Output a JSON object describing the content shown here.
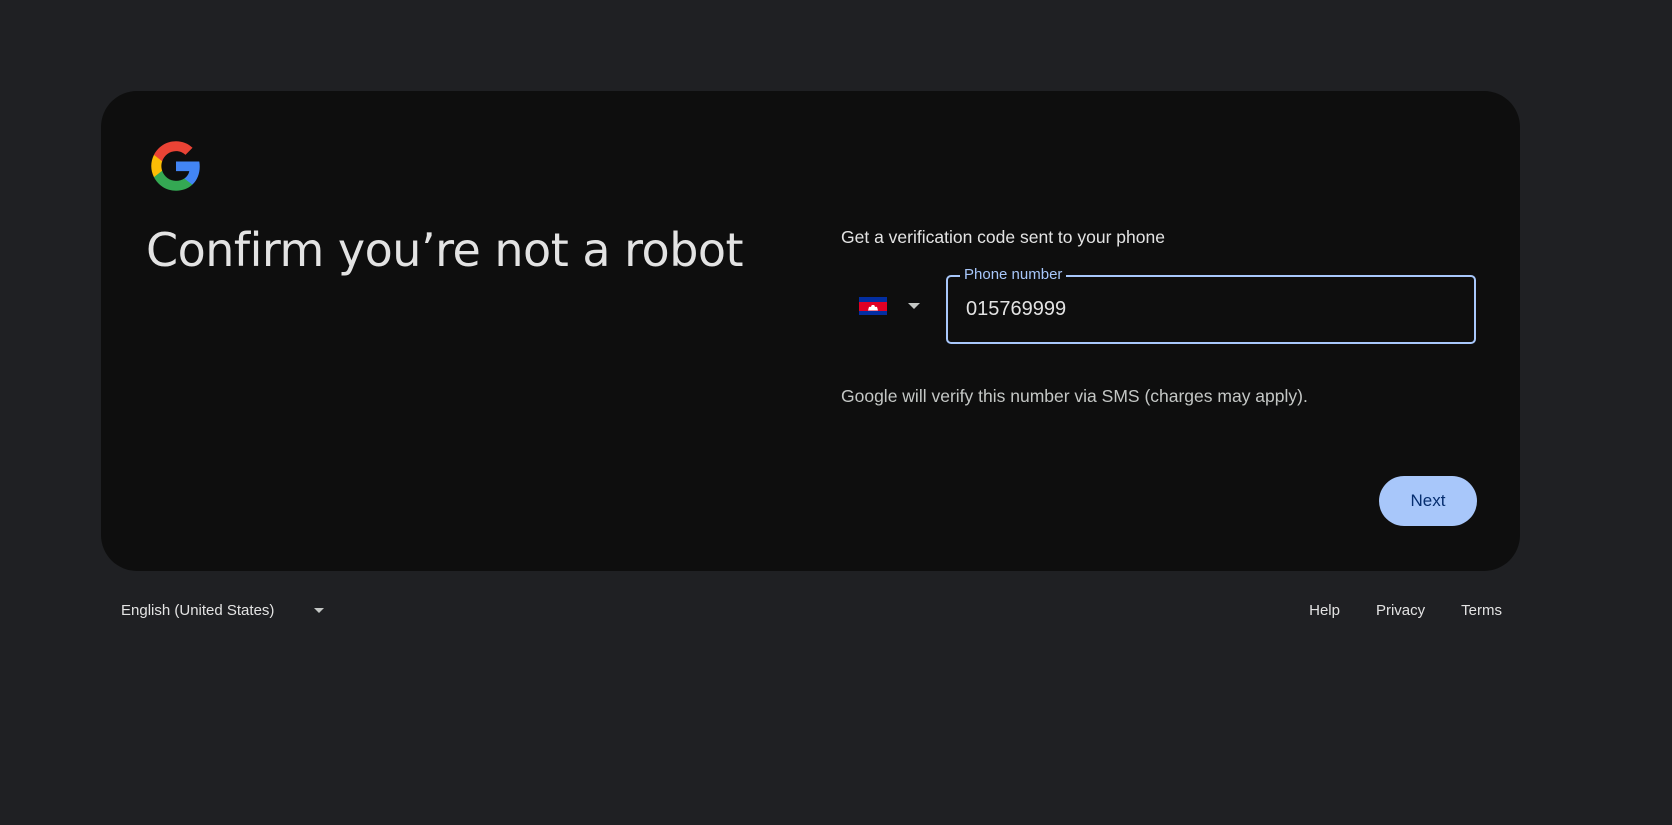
{
  "heading": "Confirm you’re not a robot",
  "logo": {
    "icon": "google-g-icon"
  },
  "verification": {
    "subtitle": "Get a verification code sent to your phone",
    "country": {
      "flag_icon": "cambodia-flag-icon"
    },
    "phone_label": "Phone number",
    "phone_value": "015769999",
    "note": "Google will verify this number via SMS (charges may apply).",
    "next_label": "Next"
  },
  "footer": {
    "language": "English (United States)",
    "links": [
      "Help",
      "Privacy",
      "Terms"
    ]
  },
  "colors": {
    "background": "#1f2023",
    "card": "#0e0e0e",
    "accent": "#a8c7fa",
    "button_text": "#062e6f"
  }
}
